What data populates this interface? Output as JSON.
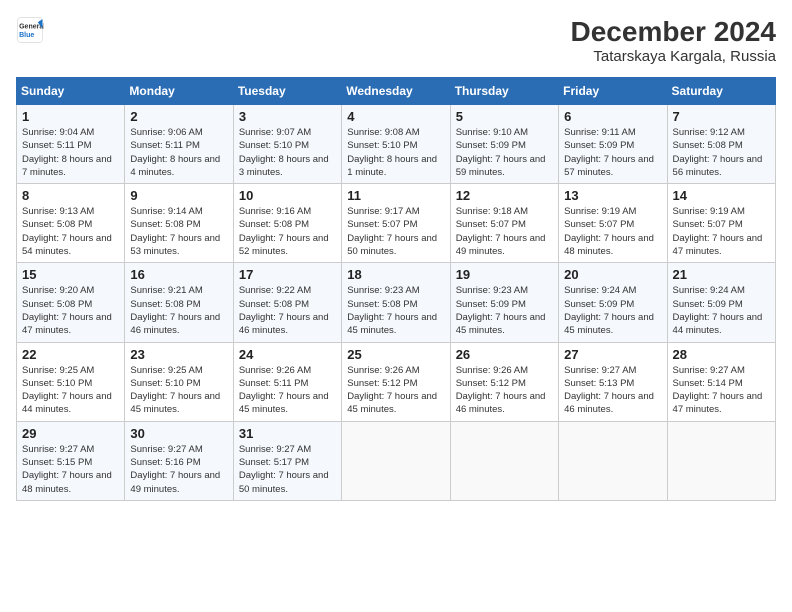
{
  "header": {
    "logo_line1": "General",
    "logo_line2": "Blue",
    "title": "December 2024",
    "subtitle": "Tatarskaya Kargala, Russia"
  },
  "weekdays": [
    "Sunday",
    "Monday",
    "Tuesday",
    "Wednesday",
    "Thursday",
    "Friday",
    "Saturday"
  ],
  "weeks": [
    [
      {
        "day": "1",
        "sunrise": "Sunrise: 9:04 AM",
        "sunset": "Sunset: 5:11 PM",
        "daylight": "Daylight: 8 hours and 7 minutes."
      },
      {
        "day": "2",
        "sunrise": "Sunrise: 9:06 AM",
        "sunset": "Sunset: 5:11 PM",
        "daylight": "Daylight: 8 hours and 4 minutes."
      },
      {
        "day": "3",
        "sunrise": "Sunrise: 9:07 AM",
        "sunset": "Sunset: 5:10 PM",
        "daylight": "Daylight: 8 hours and 3 minutes."
      },
      {
        "day": "4",
        "sunrise": "Sunrise: 9:08 AM",
        "sunset": "Sunset: 5:10 PM",
        "daylight": "Daylight: 8 hours and 1 minute."
      },
      {
        "day": "5",
        "sunrise": "Sunrise: 9:10 AM",
        "sunset": "Sunset: 5:09 PM",
        "daylight": "Daylight: 7 hours and 59 minutes."
      },
      {
        "day": "6",
        "sunrise": "Sunrise: 9:11 AM",
        "sunset": "Sunset: 5:09 PM",
        "daylight": "Daylight: 7 hours and 57 minutes."
      },
      {
        "day": "7",
        "sunrise": "Sunrise: 9:12 AM",
        "sunset": "Sunset: 5:08 PM",
        "daylight": "Daylight: 7 hours and 56 minutes."
      }
    ],
    [
      {
        "day": "8",
        "sunrise": "Sunrise: 9:13 AM",
        "sunset": "Sunset: 5:08 PM",
        "daylight": "Daylight: 7 hours and 54 minutes."
      },
      {
        "day": "9",
        "sunrise": "Sunrise: 9:14 AM",
        "sunset": "Sunset: 5:08 PM",
        "daylight": "Daylight: 7 hours and 53 minutes."
      },
      {
        "day": "10",
        "sunrise": "Sunrise: 9:16 AM",
        "sunset": "Sunset: 5:08 PM",
        "daylight": "Daylight: 7 hours and 52 minutes."
      },
      {
        "day": "11",
        "sunrise": "Sunrise: 9:17 AM",
        "sunset": "Sunset: 5:07 PM",
        "daylight": "Daylight: 7 hours and 50 minutes."
      },
      {
        "day": "12",
        "sunrise": "Sunrise: 9:18 AM",
        "sunset": "Sunset: 5:07 PM",
        "daylight": "Daylight: 7 hours and 49 minutes."
      },
      {
        "day": "13",
        "sunrise": "Sunrise: 9:19 AM",
        "sunset": "Sunset: 5:07 PM",
        "daylight": "Daylight: 7 hours and 48 minutes."
      },
      {
        "day": "14",
        "sunrise": "Sunrise: 9:19 AM",
        "sunset": "Sunset: 5:07 PM",
        "daylight": "Daylight: 7 hours and 47 minutes."
      }
    ],
    [
      {
        "day": "15",
        "sunrise": "Sunrise: 9:20 AM",
        "sunset": "Sunset: 5:08 PM",
        "daylight": "Daylight: 7 hours and 47 minutes."
      },
      {
        "day": "16",
        "sunrise": "Sunrise: 9:21 AM",
        "sunset": "Sunset: 5:08 PM",
        "daylight": "Daylight: 7 hours and 46 minutes."
      },
      {
        "day": "17",
        "sunrise": "Sunrise: 9:22 AM",
        "sunset": "Sunset: 5:08 PM",
        "daylight": "Daylight: 7 hours and 46 minutes."
      },
      {
        "day": "18",
        "sunrise": "Sunrise: 9:23 AM",
        "sunset": "Sunset: 5:08 PM",
        "daylight": "Daylight: 7 hours and 45 minutes."
      },
      {
        "day": "19",
        "sunrise": "Sunrise: 9:23 AM",
        "sunset": "Sunset: 5:09 PM",
        "daylight": "Daylight: 7 hours and 45 minutes."
      },
      {
        "day": "20",
        "sunrise": "Sunrise: 9:24 AM",
        "sunset": "Sunset: 5:09 PM",
        "daylight": "Daylight: 7 hours and 45 minutes."
      },
      {
        "day": "21",
        "sunrise": "Sunrise: 9:24 AM",
        "sunset": "Sunset: 5:09 PM",
        "daylight": "Daylight: 7 hours and 44 minutes."
      }
    ],
    [
      {
        "day": "22",
        "sunrise": "Sunrise: 9:25 AM",
        "sunset": "Sunset: 5:10 PM",
        "daylight": "Daylight: 7 hours and 44 minutes."
      },
      {
        "day": "23",
        "sunrise": "Sunrise: 9:25 AM",
        "sunset": "Sunset: 5:10 PM",
        "daylight": "Daylight: 7 hours and 45 minutes."
      },
      {
        "day": "24",
        "sunrise": "Sunrise: 9:26 AM",
        "sunset": "Sunset: 5:11 PM",
        "daylight": "Daylight: 7 hours and 45 minutes."
      },
      {
        "day": "25",
        "sunrise": "Sunrise: 9:26 AM",
        "sunset": "Sunset: 5:12 PM",
        "daylight": "Daylight: 7 hours and 45 minutes."
      },
      {
        "day": "26",
        "sunrise": "Sunrise: 9:26 AM",
        "sunset": "Sunset: 5:12 PM",
        "daylight": "Daylight: 7 hours and 46 minutes."
      },
      {
        "day": "27",
        "sunrise": "Sunrise: 9:27 AM",
        "sunset": "Sunset: 5:13 PM",
        "daylight": "Daylight: 7 hours and 46 minutes."
      },
      {
        "day": "28",
        "sunrise": "Sunrise: 9:27 AM",
        "sunset": "Sunset: 5:14 PM",
        "daylight": "Daylight: 7 hours and 47 minutes."
      }
    ],
    [
      {
        "day": "29",
        "sunrise": "Sunrise: 9:27 AM",
        "sunset": "Sunset: 5:15 PM",
        "daylight": "Daylight: 7 hours and 48 minutes."
      },
      {
        "day": "30",
        "sunrise": "Sunrise: 9:27 AM",
        "sunset": "Sunset: 5:16 PM",
        "daylight": "Daylight: 7 hours and 49 minutes."
      },
      {
        "day": "31",
        "sunrise": "Sunrise: 9:27 AM",
        "sunset": "Sunset: 5:17 PM",
        "daylight": "Daylight: 7 hours and 50 minutes."
      },
      null,
      null,
      null,
      null
    ]
  ]
}
